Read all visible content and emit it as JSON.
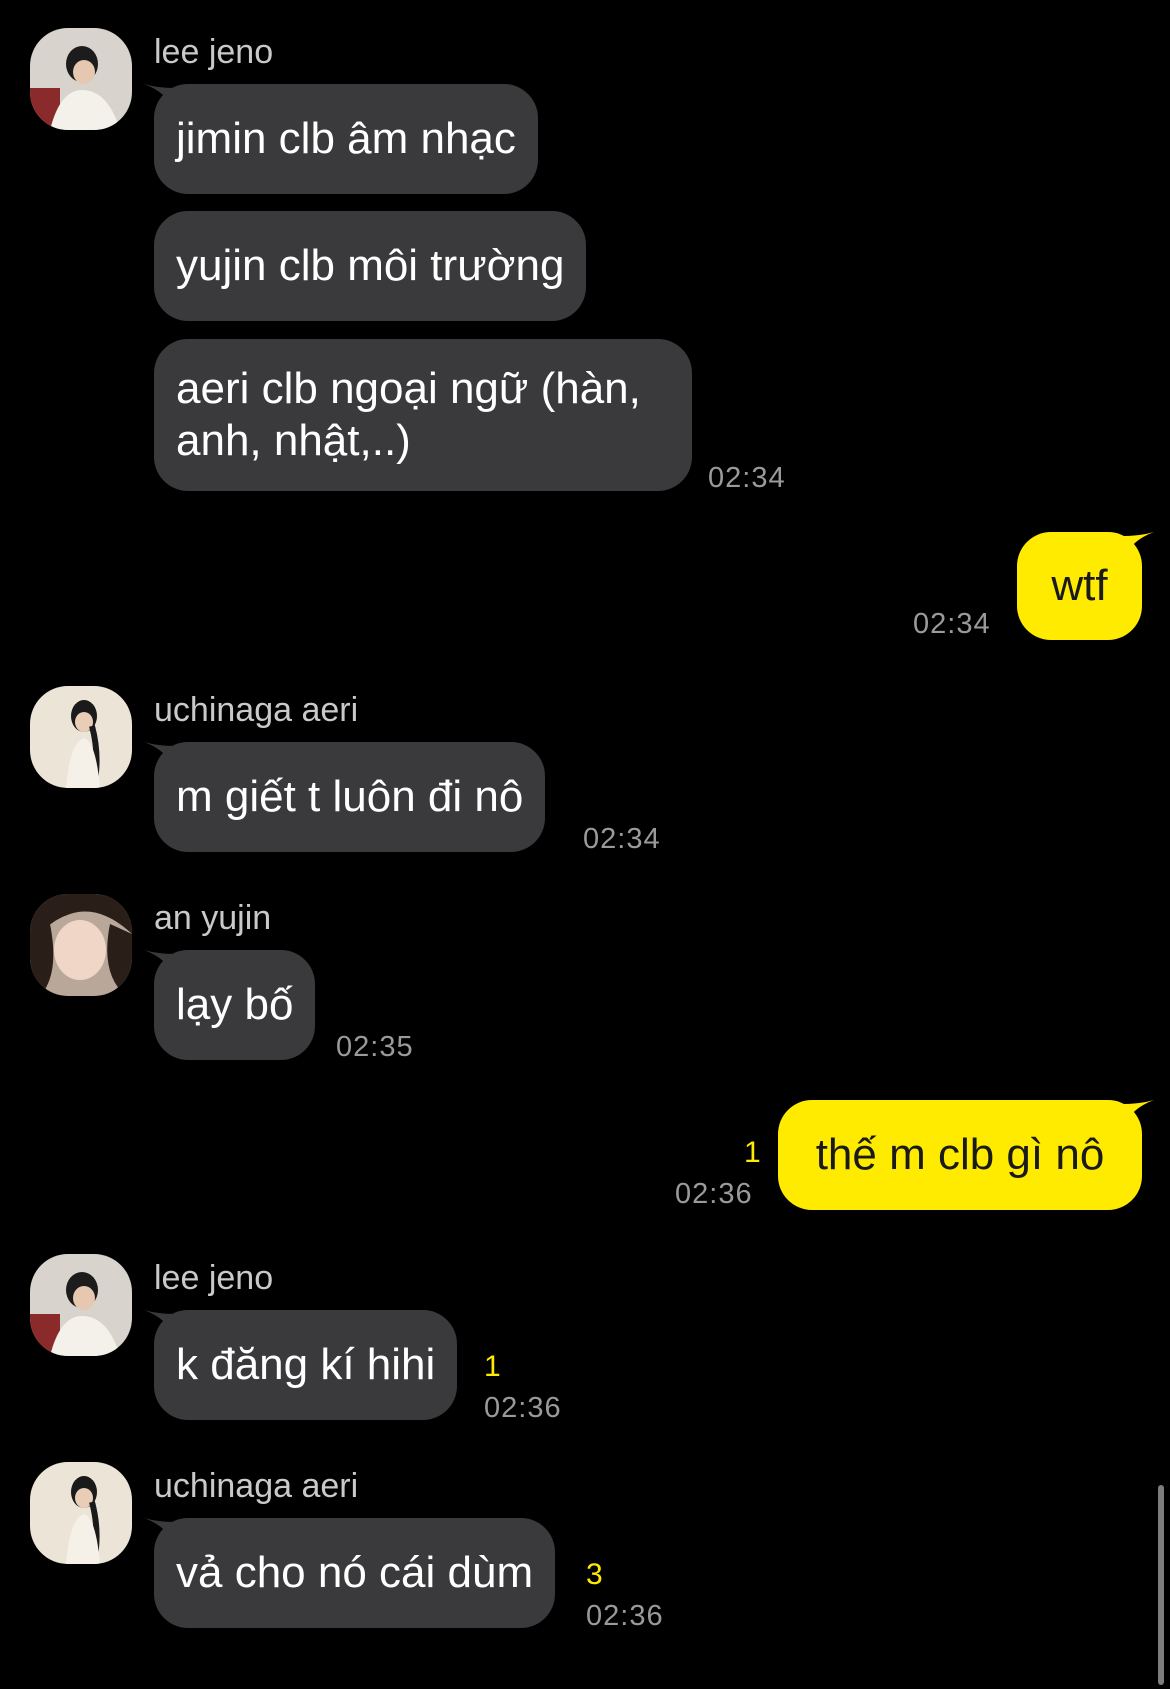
{
  "messages": {
    "m1": {
      "sender": "lee jeno",
      "bubbles": [
        "jimin clb âm nhạc",
        "yujin clb môi trường",
        "aeri clb ngoại ngữ (hàn,\nanh, nhật,..)"
      ],
      "time": "02:34"
    },
    "m2": {
      "text": "wtf",
      "time": "02:34"
    },
    "m3": {
      "sender": "uchinaga aeri",
      "text": "m giết t luôn đi nô",
      "time": "02:34"
    },
    "m4": {
      "sender": "an yujin",
      "text": "lạy bố",
      "time": "02:35"
    },
    "m5": {
      "text": "thế m clb gì nô",
      "unread": "1",
      "time": "02:36"
    },
    "m6": {
      "sender": "lee jeno",
      "text": "k đăng kí hihi",
      "unread": "1",
      "time": "02:36"
    },
    "m7": {
      "sender": "uchinaga aeri",
      "text": "vả cho nó cái dùm",
      "unread": "3",
      "time": "02:36"
    }
  },
  "colors": {
    "background": "#000000",
    "incoming_bubble": "#3a3a3c",
    "outgoing_bubble": "#ffeb00",
    "unread_count": "#ffeb00"
  }
}
